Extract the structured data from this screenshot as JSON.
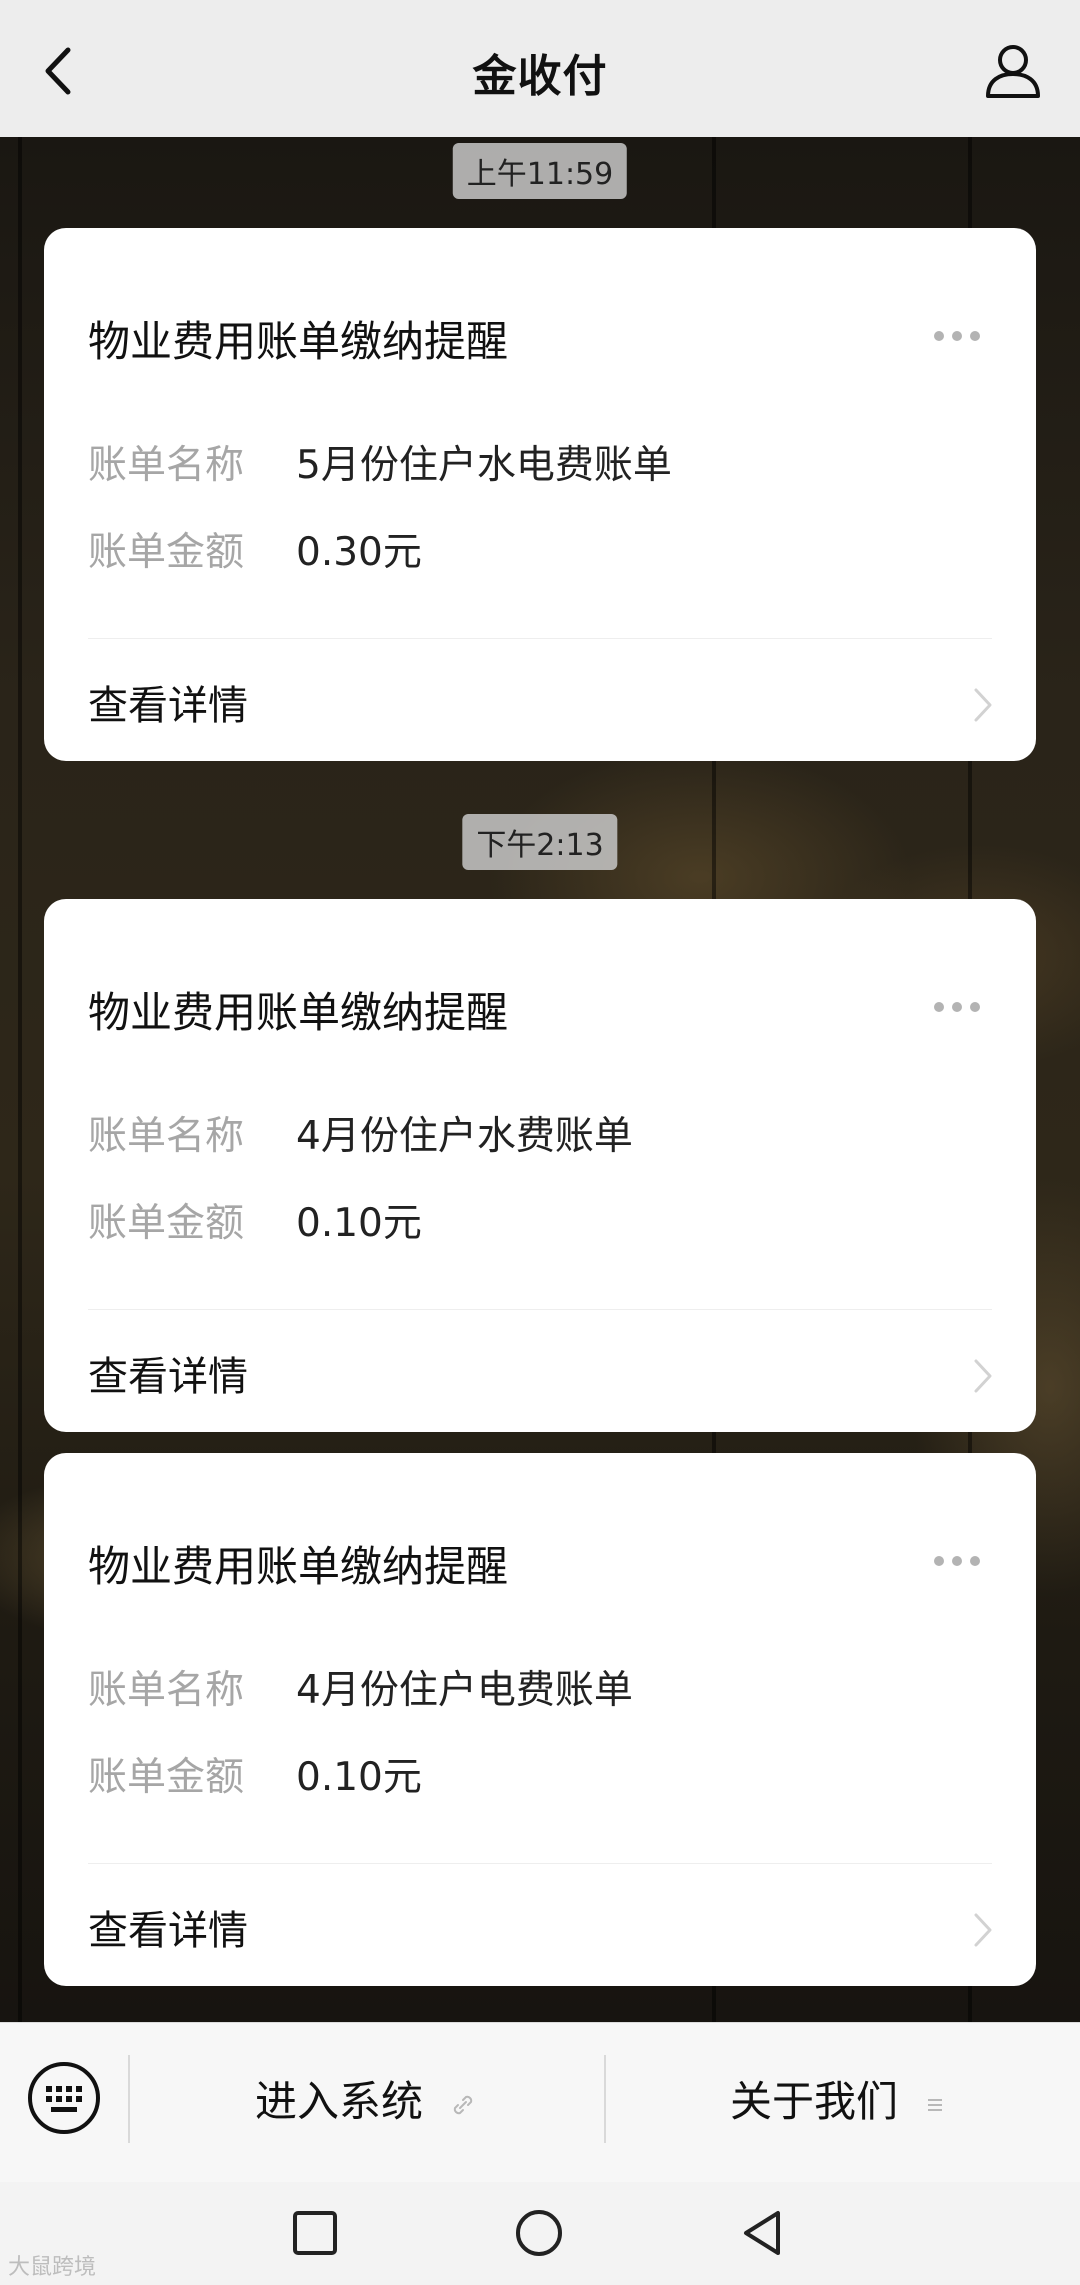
{
  "header": {
    "title": "金收付",
    "back_icon": "chevron-left-icon",
    "profile_icon": "person-icon"
  },
  "messages": [
    {
      "timestamp": "上午11:59",
      "card": {
        "title": "物业费用账单缴纳提醒",
        "fields": [
          {
            "label": "账单名称",
            "value": "5月份住户水电费账单"
          },
          {
            "label": "账单金额",
            "value": "0.30元"
          }
        ],
        "link_label": "查看详情"
      }
    },
    {
      "timestamp": "下午2:13",
      "card": {
        "title": "物业费用账单缴纳提醒",
        "fields": [
          {
            "label": "账单名称",
            "value": "4月份住户水费账单"
          },
          {
            "label": "账单金额",
            "value": "0.10元"
          }
        ],
        "link_label": "查看详情"
      }
    },
    {
      "card": {
        "title": "物业费用账单缴纳提醒",
        "fields": [
          {
            "label": "账单名称",
            "value": "4月份住户电费账单"
          },
          {
            "label": "账单金额",
            "value": "0.10元"
          }
        ],
        "link_label": "查看详情"
      }
    }
  ],
  "bottom_menu": {
    "keyboard_icon": "keyboard-icon",
    "items": [
      {
        "label": "进入系统",
        "icon": "link-icon"
      },
      {
        "label": "关于我们",
        "icon": "list-icon"
      }
    ]
  },
  "system_nav": {
    "icons": [
      "recent-apps-icon",
      "home-icon",
      "back-icon"
    ]
  },
  "watermark": "大鼠跨境"
}
